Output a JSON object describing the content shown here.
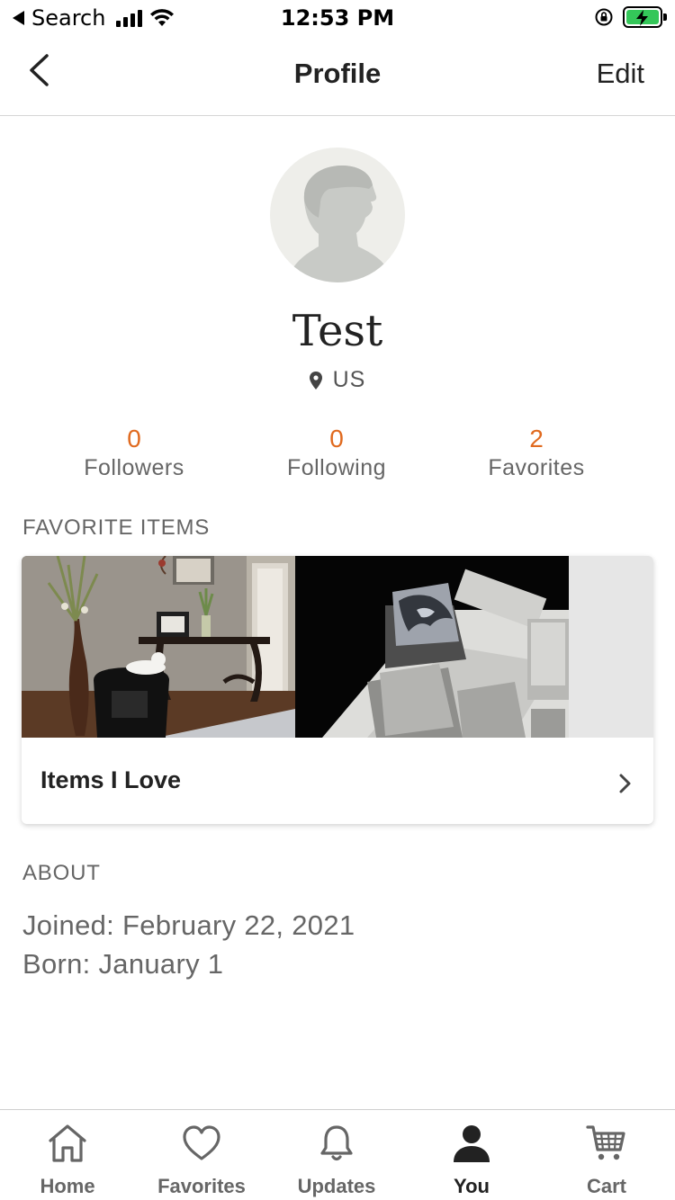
{
  "status_bar": {
    "back_app": "Search",
    "time": "12:53 PM"
  },
  "header": {
    "title": "Profile",
    "edit_label": "Edit"
  },
  "profile": {
    "name": "Test",
    "location": "US"
  },
  "stats": [
    {
      "count": "0",
      "label": "Followers"
    },
    {
      "count": "0",
      "label": "Following"
    },
    {
      "count": "2",
      "label": "Favorites"
    }
  ],
  "favorite_items": {
    "section_title": "FAVORITE ITEMS",
    "collection_title": "Items I Love"
  },
  "about": {
    "section_title": "ABOUT",
    "joined": "Joined: February 22, 2021",
    "born": "Born: January 1"
  },
  "tabs": [
    {
      "label": "Home",
      "icon": "home-icon",
      "active": false
    },
    {
      "label": "Favorites",
      "icon": "heart-icon",
      "active": false
    },
    {
      "label": "Updates",
      "icon": "bell-icon",
      "active": false
    },
    {
      "label": "You",
      "icon": "person-icon",
      "active": true
    },
    {
      "label": "Cart",
      "icon": "cart-icon",
      "active": false
    }
  ],
  "colors": {
    "accent_orange": "#e06a1f",
    "battery_green": "#34c759",
    "text_primary": "#222222",
    "text_secondary": "#666666"
  }
}
